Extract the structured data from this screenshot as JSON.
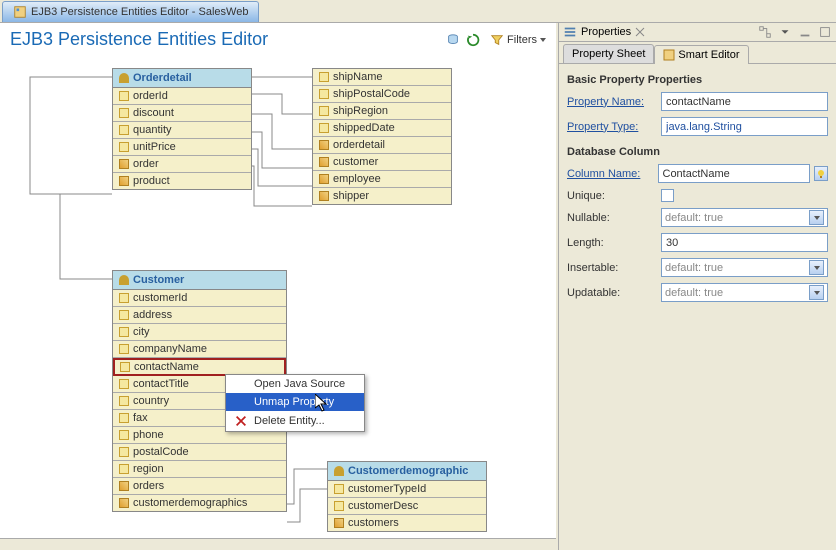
{
  "tab_title": "EJB3 Persistence Entities Editor - SalesWeb",
  "editor_title": "EJB3 Persistence Entities Editor",
  "filters_label": "Filters",
  "entities": {
    "orderdetail": {
      "name": "Orderdetail",
      "rows": [
        "orderId",
        "discount",
        "quantity",
        "unitPrice",
        "order",
        "product"
      ]
    },
    "shipper_rel": {
      "rows": [
        "shipName",
        "shipPostalCode",
        "shipRegion",
        "shippedDate",
        "orderdetail",
        "customer",
        "employee",
        "shipper"
      ]
    },
    "customer": {
      "name": "Customer",
      "rows": [
        "customerId",
        "address",
        "city",
        "companyName",
        "contactName",
        "contactTitle",
        "country",
        "fax",
        "phone",
        "postalCode",
        "region",
        "orders",
        "customerdemographics"
      ]
    },
    "customerdemo": {
      "name": "Customerdemographic",
      "rows": [
        "customerTypeId",
        "customerDesc",
        "customers"
      ]
    }
  },
  "context_menu": {
    "items": [
      "Open Java Source",
      "Unmap Property",
      "Delete Entity..."
    ]
  },
  "props_panel": {
    "title": "Properties",
    "tabs": [
      "Property Sheet",
      "Smart Editor"
    ],
    "basic_section": "Basic Property Properties",
    "property_name_label": "Property Name:",
    "property_name_value": "contactName",
    "property_type_label": "Property Type:",
    "property_type_value": "java.lang.String",
    "db_section": "Database Column",
    "column_name_label": "Column Name:",
    "column_name_value": "ContactName",
    "unique_label": "Unique:",
    "nullable_label": "Nullable:",
    "nullable_value": "default: true",
    "length_label": "Length:",
    "length_value": "30",
    "insertable_label": "Insertable:",
    "insertable_value": "default: true",
    "updatable_label": "Updatable:",
    "updatable_value": "default: true"
  }
}
